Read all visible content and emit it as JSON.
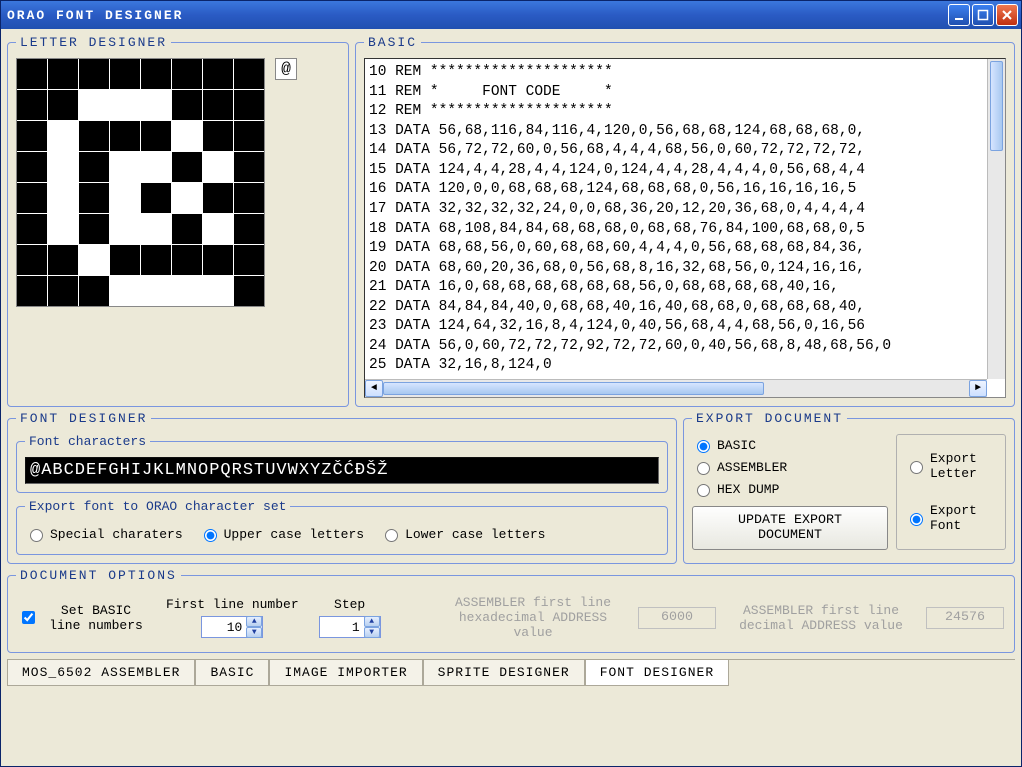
{
  "window": {
    "title": "ORAO  FONT  DESIGNER"
  },
  "letter_designer": {
    "legend": "LETTER DESIGNER",
    "grid": [
      [
        0,
        0,
        0,
        0,
        0,
        0,
        0,
        0
      ],
      [
        0,
        0,
        1,
        1,
        1,
        0,
        0,
        0
      ],
      [
        0,
        1,
        0,
        0,
        0,
        1,
        0,
        0
      ],
      [
        0,
        1,
        0,
        1,
        1,
        0,
        1,
        0
      ],
      [
        0,
        1,
        0,
        1,
        0,
        1,
        0,
        0
      ],
      [
        0,
        1,
        0,
        1,
        1,
        0,
        1,
        0
      ],
      [
        0,
        0,
        1,
        0,
        0,
        0,
        0,
        0
      ],
      [
        0,
        0,
        0,
        1,
        1,
        1,
        1,
        0
      ]
    ],
    "preview_char": "@"
  },
  "basic": {
    "legend": "BASIC",
    "lines": [
      "10 REM *********************",
      "11 REM *     FONT CODE     *",
      "12 REM *********************",
      "13 DATA 56,68,116,84,116,4,120,0,56,68,68,124,68,68,68,0,",
      "14 DATA 56,72,72,60,0,56,68,4,4,4,68,56,0,60,72,72,72,72,",
      "15 DATA 124,4,4,28,4,4,124,0,124,4,4,28,4,4,4,0,56,68,4,4",
      "16 DATA 120,0,0,68,68,68,124,68,68,68,0,56,16,16,16,16,5",
      "17 DATA 32,32,32,32,24,0,0,68,36,20,12,20,36,68,0,4,4,4,4",
      "18 DATA 68,108,84,84,68,68,68,0,68,68,76,84,100,68,68,0,5",
      "19 DATA 68,68,56,0,60,68,68,60,4,4,4,0,56,68,68,68,84,36,",
      "20 DATA 68,60,20,36,68,0,56,68,8,16,32,68,56,0,124,16,16,",
      "21 DATA 16,0,68,68,68,68,68,68,56,0,68,68,68,68,40,16,",
      "22 DATA 84,84,84,40,0,68,68,40,16,40,68,68,0,68,68,68,40,",
      "23 DATA 124,64,32,16,8,4,124,0,40,56,68,4,4,68,56,0,16,56",
      "24 DATA 56,0,60,72,72,72,92,72,72,60,0,40,56,68,8,48,68,56,0",
      "25 DATA 32,16,8,124,0"
    ]
  },
  "font_designer": {
    "legend": "FONT DESIGNER",
    "chars_legend": "Font characters",
    "chars_string": "@ABCDEFGHIJKLMNOPQRSTUVWXYZČĆĐŠŽ",
    "export_set_legend": "Export font to ORAO character set",
    "export_set_options": {
      "special": "Special charaters",
      "upper": "Upper case letters",
      "lower": "Lower case letters"
    },
    "export_set_selected": "upper"
  },
  "export_doc": {
    "legend": "EXPORT DOCUMENT",
    "format_options": {
      "basic": "BASIC",
      "asm": "ASSEMBLER",
      "hex": "HEX DUMP"
    },
    "format_selected": "basic",
    "scope_options": {
      "letter": "Export Letter",
      "font": "Export Font"
    },
    "scope_selected": "font",
    "update_button": "UPDATE EXPORT DOCUMENT"
  },
  "doc_options": {
    "legend": "DOCUMENT OPTIONS",
    "set_basic_label": "Set BASIC line numbers",
    "set_basic_checked": true,
    "first_line_label": "First line number",
    "first_line_value": "10",
    "step_label": "Step",
    "step_value": "1",
    "asm_hex_label": "ASSEMBLER first line hexadecimal ADDRESS value",
    "asm_hex_value": "6000",
    "asm_dec_label": "ASSEMBLER first line decimal ADDRESS value",
    "asm_dec_value": "24576"
  },
  "tabs": {
    "items": [
      "MOS_6502 ASSEMBLER",
      "BASIC",
      "IMAGE IMPORTER",
      "SPRITE DESIGNER",
      "FONT DESIGNER"
    ],
    "active_index": 4
  }
}
